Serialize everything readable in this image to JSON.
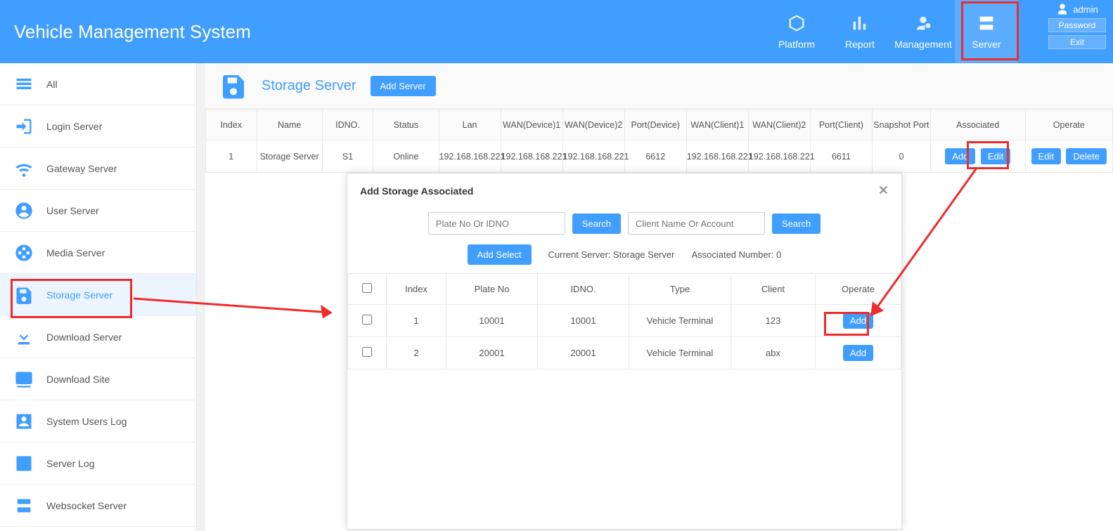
{
  "header": {
    "title": "Vehicle Management System",
    "nav": {
      "platform": "Platform",
      "report": "Report",
      "management": "Management",
      "server": "Server"
    },
    "user": {
      "name": "admin",
      "password_btn": "Password",
      "exit_btn": "Exit"
    }
  },
  "sidebar": {
    "all": "All",
    "login": "Login Server",
    "gateway": "Gateway Server",
    "user": "User Server",
    "media": "Media Server",
    "storage": "Storage Server",
    "download": "Download Server",
    "download_site": "Download Site",
    "sys_users_log": "System Users Log",
    "server_log": "Server Log",
    "websocket": "Websocket Server"
  },
  "page": {
    "title": "Storage Server",
    "add_btn": "Add Server"
  },
  "table": {
    "headers": {
      "index": "Index",
      "name": "Name",
      "idno": "IDNO.",
      "status": "Status",
      "lan": "Lan",
      "wan_dev1": "WAN(Device)1",
      "wan_dev2": "WAN(Device)2",
      "port_dev": "Port(Device)",
      "wan_cli1": "WAN(Client)1",
      "wan_cli2": "WAN(Client)2",
      "port_cli": "Port(Client)",
      "snap": "Snapshot Port",
      "assoc": "Associated",
      "operate": "Operate"
    },
    "row": {
      "index": "1",
      "name": "Storage Server",
      "idno": "S1",
      "status": "Online",
      "lan": "192.168.168.221",
      "wan_dev1": "192.168.168.221",
      "wan_dev2": "192.168.168.221",
      "port_dev": "6612",
      "wan_cli1": "192.168.168.221",
      "wan_cli2": "192.168.168.221",
      "port_cli": "6611",
      "snap": "0"
    },
    "buttons": {
      "add": "Add",
      "edit": "Edit",
      "delete": "Delete"
    }
  },
  "dialog": {
    "title": "Add Storage Associated",
    "plate_ph": "Plate No Or IDNO",
    "client_ph": "Client Name Or Account",
    "search_btn": "Search",
    "add_select": "Add Select",
    "current_server": "Current Server: Storage Server",
    "assoc_number": "Associated Number: 0",
    "headers": {
      "index": "Index",
      "plate": "Plate No",
      "idno": "IDNO.",
      "type": "Type",
      "client": "Client",
      "operate": "Operate"
    },
    "rows": [
      {
        "index": "1",
        "plate": "10001",
        "idno": "10001",
        "type": "Vehicle Terminal",
        "client": "123"
      },
      {
        "index": "2",
        "plate": "20001",
        "idno": "20001",
        "type": "Vehicle Terminal",
        "client": "abx"
      }
    ],
    "add_btn": "Add"
  }
}
